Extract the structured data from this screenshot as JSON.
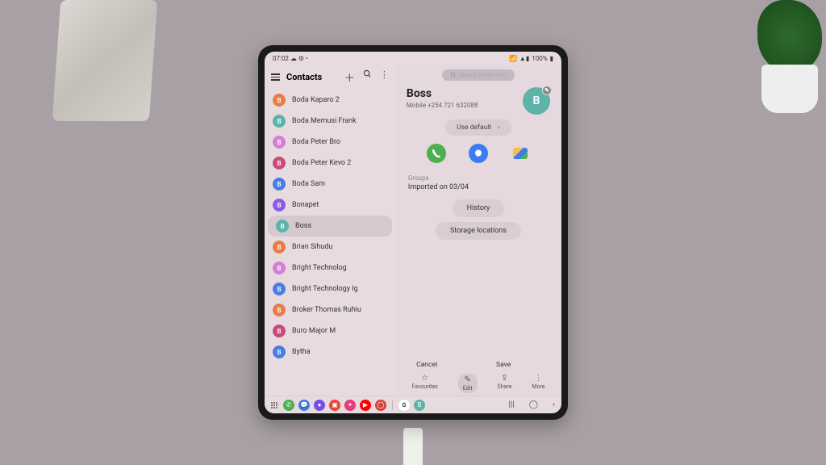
{
  "statusbar": {
    "time": "07:02",
    "battery": "100%"
  },
  "app_title": "Contacts",
  "contacts": [
    {
      "initial": "B",
      "name": "Boda Kaparo 2",
      "color": "#e67e4a"
    },
    {
      "initial": "B",
      "name": "Boda Memusi Frank",
      "color": "#5cb3a8"
    },
    {
      "initial": "B",
      "name": "Boda Peter Bro",
      "color": "#d47fd4"
    },
    {
      "initial": "B",
      "name": "Boda Peter Kevo 2",
      "color": "#c94a7a"
    },
    {
      "initial": "B",
      "name": "Boda Sam",
      "color": "#4a7ce6"
    },
    {
      "initial": "B",
      "name": "Bonapet",
      "color": "#8a5ce6"
    },
    {
      "initial": "B",
      "name": "Boss",
      "color": "#5cb3a8",
      "selected": true
    },
    {
      "initial": "B",
      "name": "Brian Sihudu",
      "color": "#e67e4a"
    },
    {
      "initial": "B",
      "name": "Bright Technolog",
      "color": "#d47fd4"
    },
    {
      "initial": "B",
      "name": "Bright Technology Ig",
      "color": "#4a7ce6"
    },
    {
      "initial": "B",
      "name": "Broker Thomas Ruhiu",
      "color": "#e67e4a"
    },
    {
      "initial": "B",
      "name": "Buro Major M",
      "color": "#c94a7a"
    },
    {
      "initial": "B",
      "name": "Bytha",
      "color": "#4a7ce6"
    }
  ],
  "detail": {
    "name": "Boss",
    "mobile_label": "Mobile",
    "mobile_value": "+254 721 632088",
    "initial": "B",
    "default_chip": "Use default",
    "groups_label": "Groups",
    "groups_value": "Imported on 03/04",
    "history_label": "History",
    "storage_label": "Storage locations",
    "dialog_cancel": "Cancel",
    "dialog_save": "Save"
  },
  "bottom_actions": [
    {
      "label": "Favourites"
    },
    {
      "label": "Edit",
      "selected": true
    },
    {
      "label": "Share"
    },
    {
      "label": "More"
    }
  ]
}
